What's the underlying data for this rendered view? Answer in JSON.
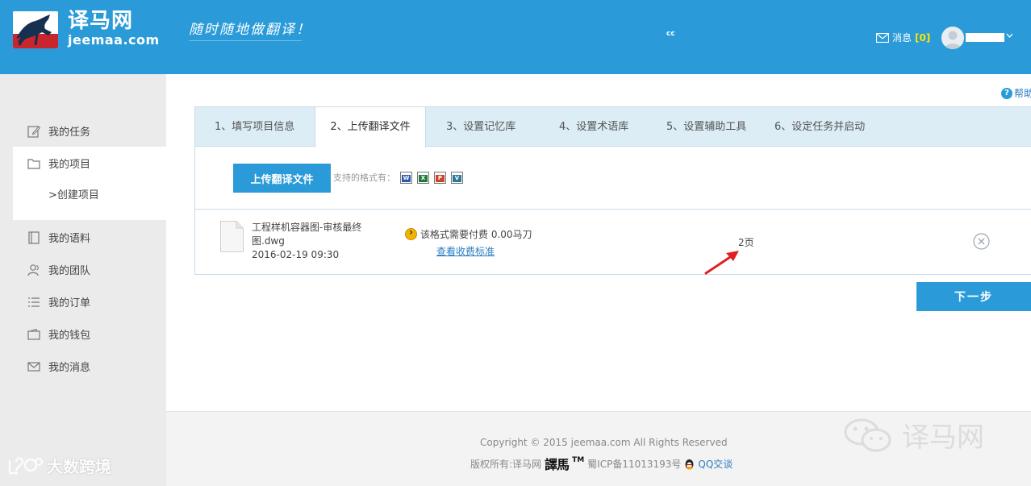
{
  "header": {
    "logo_cn": "译马网",
    "logo_en": "jeemaa.com",
    "slogan": "随时随地做翻译！",
    "cc": "cc",
    "messages_label": "消息",
    "messages_count": "[0]",
    "accent": "#2a9bd8"
  },
  "help": {
    "label": "帮助"
  },
  "sidebar": {
    "items": [
      {
        "label": "我的任务",
        "icon": "edit-icon"
      },
      {
        "label": "我的项目",
        "icon": "folder-icon"
      },
      {
        "label": "我的语料",
        "icon": "book-icon"
      },
      {
        "label": "我的团队",
        "icon": "team-icon"
      },
      {
        "label": "我的订单",
        "icon": "list-icon"
      },
      {
        "label": "我的钱包",
        "icon": "wallet-icon"
      },
      {
        "label": "我的消息",
        "icon": "mail-icon"
      }
    ],
    "sub_item": ">创建项目"
  },
  "steps": [
    "1、填写项目信息",
    "2、上传翻译文件",
    "3、设置记忆库",
    "4、设置术语库",
    "5、设置辅助工具",
    "6、设定任务并启动"
  ],
  "upload": {
    "button_label": "上传翻译文件",
    "formats_label": "支持的格式有："
  },
  "file": {
    "name": "工程样机容器图-审核最终图.dwg",
    "date": "2016-02-19 09:30",
    "fee_text": "该格式需要付费 0.00马刀",
    "fee_link": "查看收费标准",
    "pages": "2页"
  },
  "next_button": "下一步",
  "footer": {
    "copyright": "Copyright © 2015 jeemaa.com All Rights Reserved",
    "rights": "版权所有:译马网",
    "seal": "譯馬",
    "tm": "TM",
    "icp": "蜀ICP备11013193号",
    "qq": "QQ交谈"
  },
  "watermarks": {
    "left": "大数跨境",
    "right": "译马网"
  }
}
